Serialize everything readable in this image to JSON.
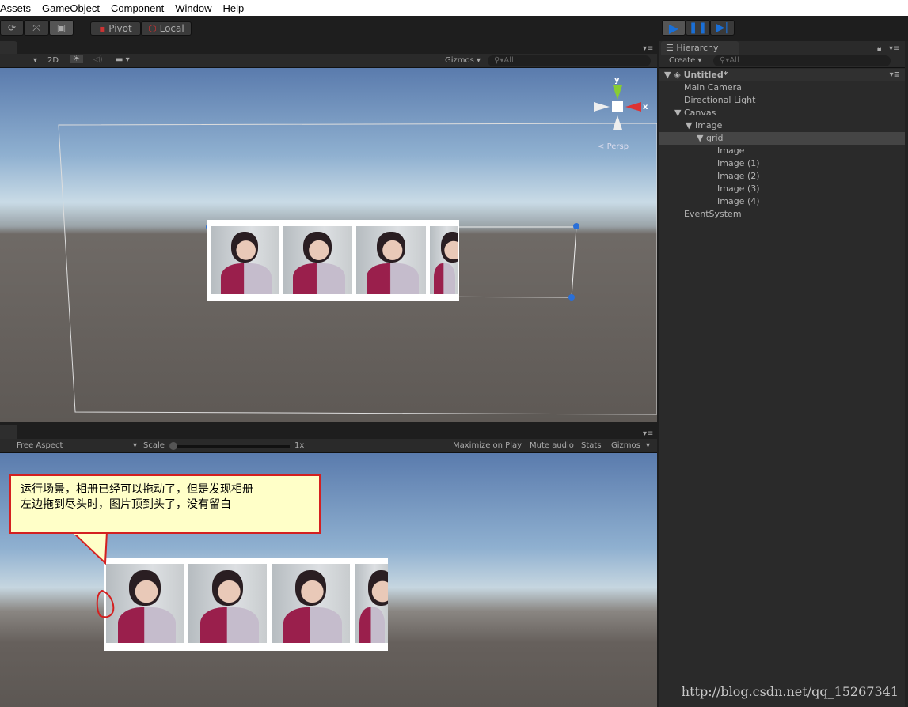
{
  "menu": [
    "Assets",
    "GameObject",
    "Component",
    "Window",
    "Help"
  ],
  "toolbar": {
    "pivot": "Pivot",
    "local": "Local"
  },
  "scene": {
    "mode_2d": "2D",
    "gizmos": "Gizmos",
    "search_placeholder": "All",
    "persp": "Persp",
    "axis_x": "x",
    "axis_y": "y"
  },
  "game": {
    "aspect": "Free Aspect",
    "scale_label": "Scale",
    "scale_value": "1x",
    "maximize": "Maximize on Play",
    "mute": "Mute audio",
    "stats": "Stats",
    "gizmos": "Gizmos"
  },
  "hierarchy": {
    "tab": "Hierarchy",
    "create": "Create",
    "search_placeholder": "All",
    "scene": "Untitled*",
    "items": [
      {
        "label": "Main Camera"
      },
      {
        "label": "Directional Light"
      },
      {
        "label": "Canvas"
      },
      {
        "label": "Image"
      },
      {
        "label": "grid"
      },
      {
        "label": "Image"
      },
      {
        "label": "Image (1)"
      },
      {
        "label": "Image (2)"
      },
      {
        "label": "Image (3)"
      },
      {
        "label": "Image (4)"
      },
      {
        "label": "EventSystem"
      }
    ]
  },
  "callout": {
    "line1": "运行场景，相册已经可以拖动了，但是发现相册",
    "line2": "左边拖到尽头时，图片顶到头了，没有留白"
  },
  "watermark": "http://blog.csdn.net/qq_15267341",
  "colors": {
    "play_accent": "#1a6fd6",
    "callout_border": "#d42020",
    "callout_bg": "#ffffc8"
  }
}
